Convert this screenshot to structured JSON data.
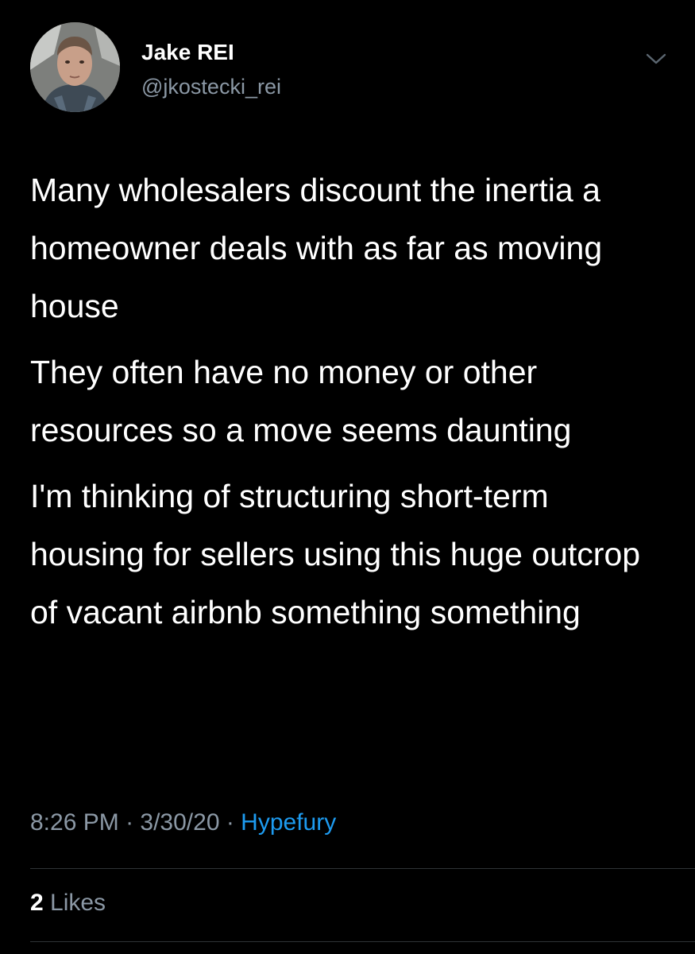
{
  "author": {
    "display_name": "Jake REI",
    "handle": "@jkostecki_rei"
  },
  "icons": {
    "menu": "chevron-down-icon",
    "avatar": "profile-photo"
  },
  "tweet": {
    "paragraphs": [
      "Many wholesalers discount the inertia a homeowner deals with as far as moving house",
      "They often have no money or other resources so a move seems daunting",
      "I'm thinking of structuring short-term housing for sellers using this huge outcrop of vacant airbnb something something"
    ]
  },
  "meta": {
    "time": "8:26 PM",
    "sep1": " · ",
    "date": "3/30/20",
    "sep2": " · ",
    "source": "Hypefury"
  },
  "engagement": {
    "likes_count": "2",
    "likes_label": " Likes"
  },
  "colors": {
    "background": "#000000",
    "text": "#ffffff",
    "secondary_text": "#8b98a5",
    "link": "#1d9bf0",
    "divider": "#2f3336"
  }
}
